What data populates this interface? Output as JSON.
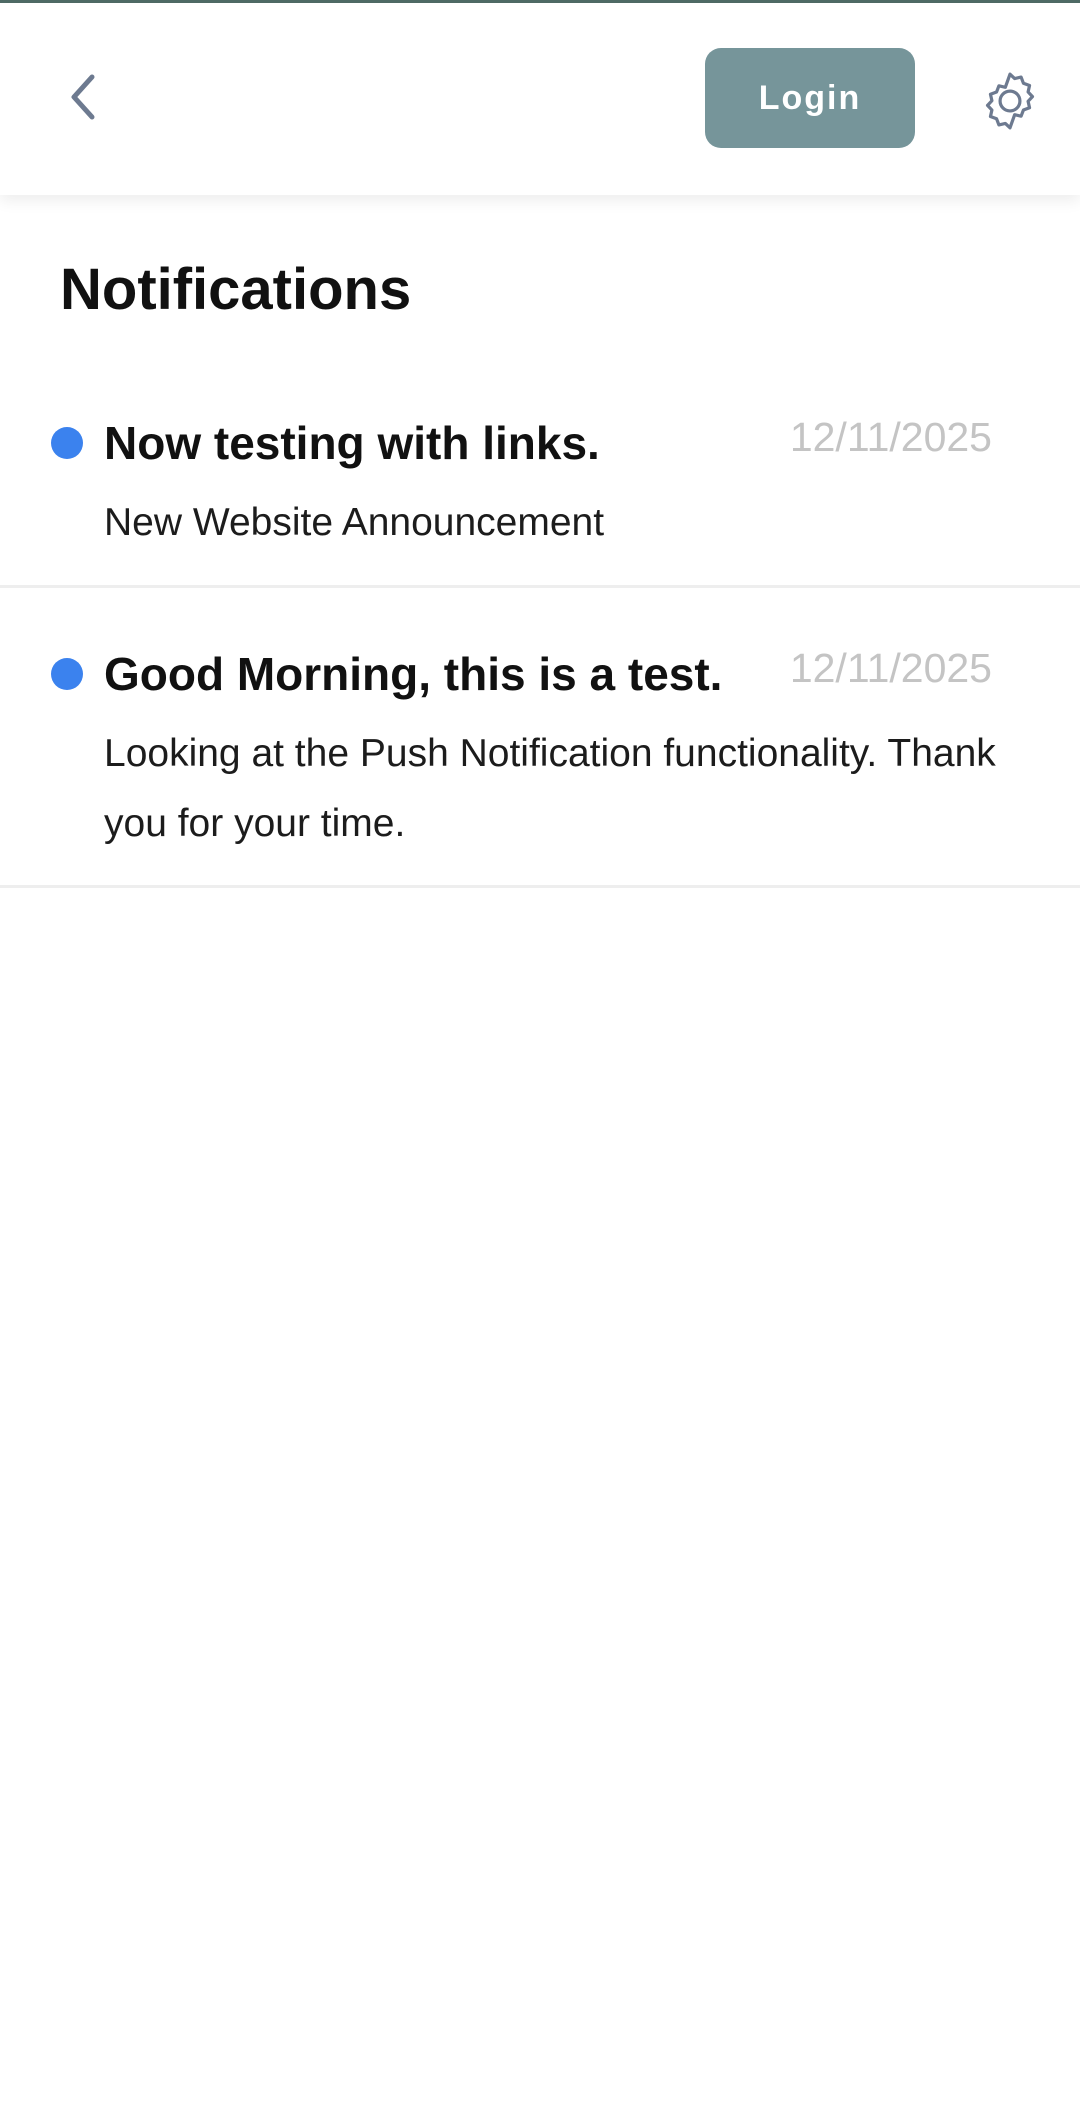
{
  "header": {
    "back_icon": "chevron-left-icon",
    "login_label": "Login",
    "settings_icon": "gear-icon",
    "accent_color": "#76959a"
  },
  "page": {
    "title": "Notifications"
  },
  "notifications": [
    {
      "title": "Now testing with links.",
      "date": "12/11/2025",
      "body": "New Website Announcement",
      "unread": true
    },
    {
      "title": "Good Morning, this is a test.",
      "date": "12/11/2025",
      "body": "Looking at the Push Notification functionality. Thank you for your time.",
      "unread": true
    }
  ],
  "colors": {
    "unread_dot": "#3b82ee",
    "date_text": "#c4c4c4"
  }
}
